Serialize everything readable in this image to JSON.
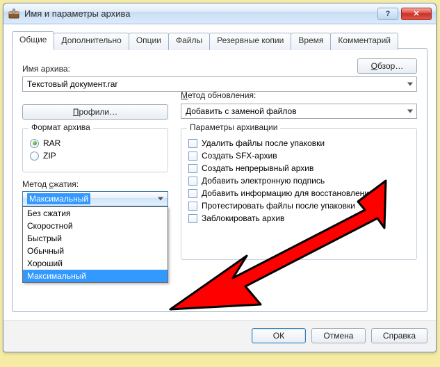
{
  "window": {
    "title": "Имя и параметры архива",
    "help": "?",
    "close": "✕"
  },
  "tabs": [
    {
      "label": "Общие"
    },
    {
      "label": "Дополнительно"
    },
    {
      "label": "Опции"
    },
    {
      "label": "Файлы"
    },
    {
      "label": "Резервные копии"
    },
    {
      "label": "Время"
    },
    {
      "label": "Комментарий"
    }
  ],
  "archive_name": {
    "label": "Имя архива:",
    "value": "Текстовый документ.rar",
    "browse": "Обзор…"
  },
  "profiles_button": "Профили…",
  "update_method": {
    "label": "Метод обновления:",
    "value": "Добавить с заменой файлов"
  },
  "format": {
    "title": "Формат архива",
    "options": [
      {
        "label": "RAR",
        "checked": true
      },
      {
        "label": "ZIP",
        "checked": false
      }
    ]
  },
  "compression": {
    "label": "Метод сжатия:",
    "value": "Максимальный",
    "options": [
      "Без сжатия",
      "Скоростной",
      "Быстрый",
      "Обычный",
      "Хороший",
      "Максимальный"
    ]
  },
  "params": {
    "title": "Параметры архивации",
    "items": [
      "Удалить файлы после упаковки",
      "Создать SFX-архив",
      "Создать непрерывный архив",
      "Добавить электронную подпись",
      "Добавить информацию для восстановления",
      "Протестировать файлы после упаковки",
      "Заблокировать архив"
    ]
  },
  "footer": {
    "ok": "ОК",
    "cancel": "Отмена",
    "help": "Справка"
  }
}
